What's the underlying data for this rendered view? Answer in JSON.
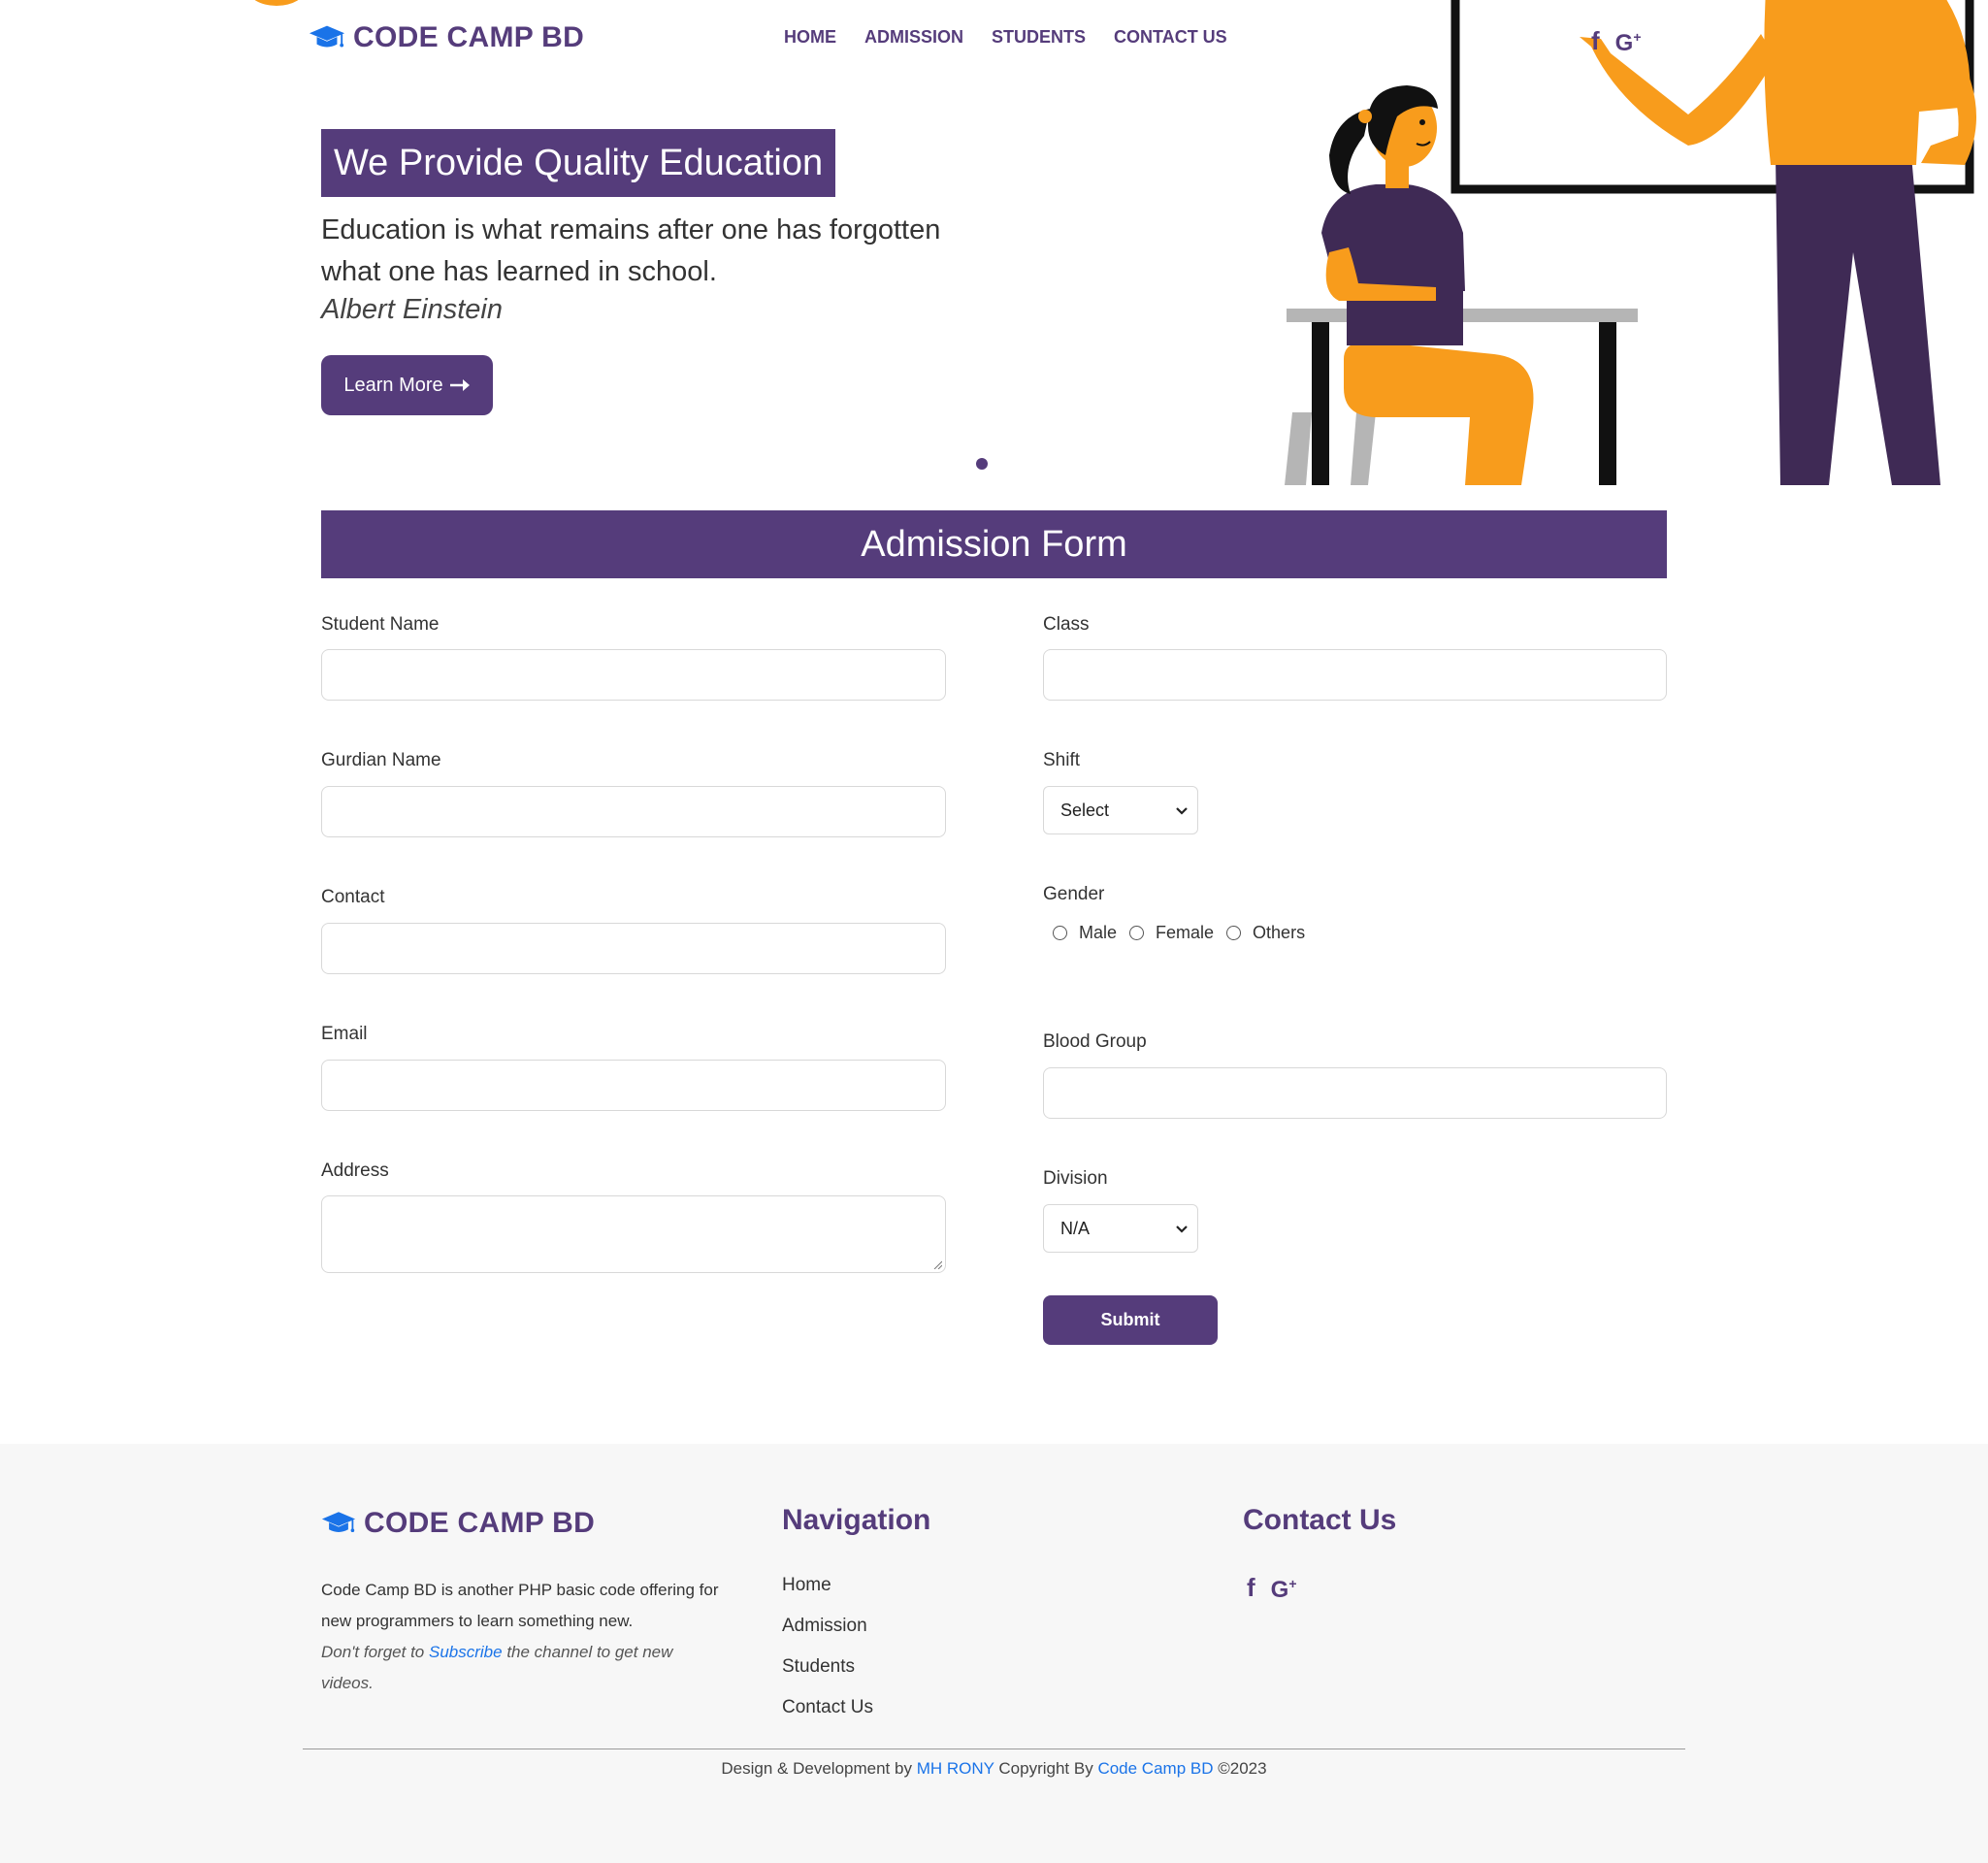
{
  "brand": {
    "name": "CODE CAMP BD",
    "icon": "graduation-cap-icon",
    "icon_color": "#1a73e8"
  },
  "nav": [
    {
      "label": "HOME"
    },
    {
      "label": "ADMISSION"
    },
    {
      "label": "STUDENTS"
    },
    {
      "label": "CONTACT US"
    }
  ],
  "social": {
    "facebook_glyph": "f",
    "google_glyph": "G",
    "google_plus": "+"
  },
  "hero": {
    "title": "We Provide Quality Education",
    "quote": "Education is what remains after one has forgotten what one has learned in school.",
    "author": "Albert Einstein",
    "button_label": "Learn More",
    "button_icon": "arrow-right-icon"
  },
  "form": {
    "title": "Admission Form",
    "student_name_label": "Student Name",
    "guardian_name_label": "Gurdian Name",
    "contact_label": "Contact",
    "email_label": "Email",
    "address_label": "Address",
    "class_label": "Class",
    "shift_label": "Shift",
    "shift_value": "Select",
    "gender_label": "Gender",
    "gender_options": [
      "Male",
      "Female",
      "Others"
    ],
    "blood_group_label": "Blood Group",
    "division_label": "Division",
    "division_value": "N/A",
    "submit_label": "Submit"
  },
  "footer": {
    "brand": "CODE CAMP BD",
    "description": "Code Camp BD is another PHP basic code offering for new programmers to learn something new.",
    "note_before": "Don't forget to ",
    "note_link": "Subscribe",
    "note_after": " the channel to get new videos.",
    "nav_heading": "Navigation",
    "nav_links": [
      "Home",
      "Admission",
      "Students",
      "Contact Us"
    ],
    "contact_heading": "Contact Us",
    "copyright_prefix": "Design & Development by ",
    "developer": "MH RONY",
    "copyright_mid": " Copyright By ",
    "company": "Code Camp BD",
    "copyright_suffix": " ©2023"
  },
  "colors": {
    "primary": "#553c7b",
    "accent_orange": "#f89c1c",
    "link": "#1a73e8",
    "footer_bg": "#f7f7f7"
  }
}
